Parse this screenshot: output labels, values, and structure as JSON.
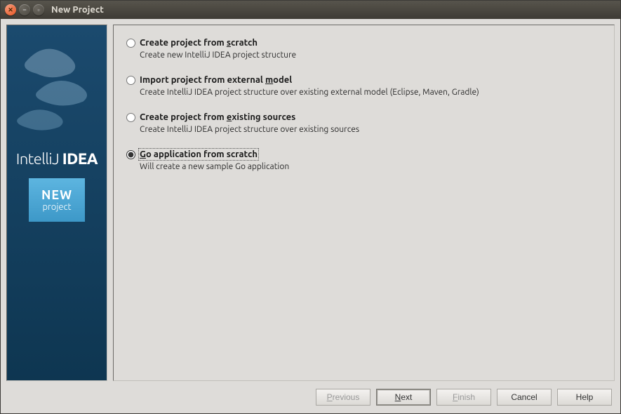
{
  "titlebar": {
    "title": "New Project"
  },
  "sidebar": {
    "logo_light": "IntelliJ",
    "logo_bold": "IDEA",
    "badge_new": "NEW",
    "badge_proj": "project"
  },
  "options": [
    {
      "id": "scratch",
      "title_pre": "Create project from ",
      "mnemonic": "s",
      "title_post": "cratch",
      "desc": "Create new IntelliJ IDEA project structure",
      "selected": false
    },
    {
      "id": "import",
      "title_pre": "Import project from external ",
      "mnemonic": "m",
      "title_post": "odel",
      "desc": "Create IntelliJ IDEA project structure over existing external model (Eclipse, Maven, Gradle)",
      "selected": false
    },
    {
      "id": "existing",
      "title_pre": "Create project from ",
      "mnemonic": "e",
      "title_post": "xisting sources",
      "desc": "Create IntelliJ IDEA project structure over existing sources",
      "selected": false
    },
    {
      "id": "go",
      "title_pre": "",
      "mnemonic": "G",
      "title_post": "o application from scratch",
      "desc": "Will create a new sample Go application",
      "selected": true
    }
  ],
  "buttons": {
    "previous": "Previous",
    "previous_mn": "P",
    "next": "Next",
    "next_mn": "N",
    "finish": "Finish",
    "finish_mn": "F",
    "cancel": "Cancel",
    "help": "Help"
  }
}
